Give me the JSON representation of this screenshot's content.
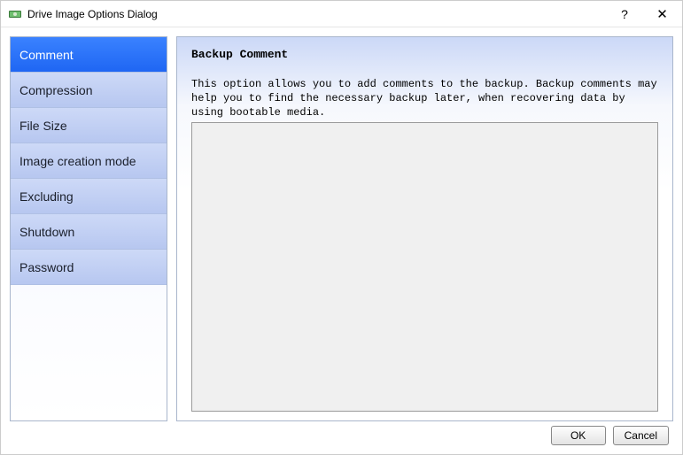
{
  "window": {
    "title": "Drive Image Options Dialog"
  },
  "sidebar": {
    "items": [
      {
        "label": "Comment",
        "selected": true
      },
      {
        "label": "Compression",
        "selected": false
      },
      {
        "label": "File Size",
        "selected": false
      },
      {
        "label": "Image creation mode",
        "selected": false
      },
      {
        "label": "Excluding",
        "selected": false
      },
      {
        "label": "Shutdown",
        "selected": false
      },
      {
        "label": "Password",
        "selected": false
      }
    ]
  },
  "panel": {
    "title": "Backup Comment",
    "description": "This option allows you to add comments to the backup. Backup comments may help you to find the necessary backup later, when recovering data by using bootable media.",
    "comment_value": ""
  },
  "footer": {
    "ok_label": "OK",
    "cancel_label": "Cancel"
  }
}
